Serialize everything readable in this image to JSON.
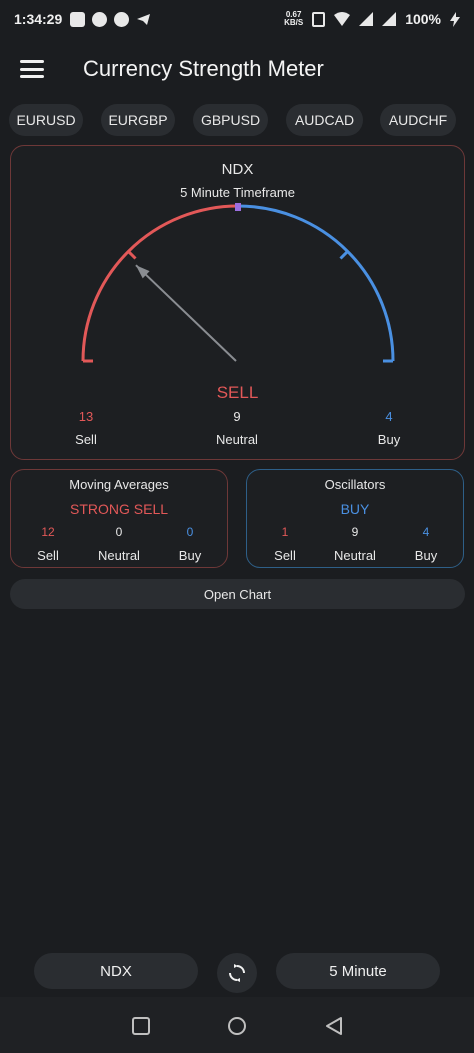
{
  "status_bar": {
    "time": "1:34:29",
    "speed_value": "0.67",
    "speed_unit": "KB/S",
    "battery": "100%"
  },
  "app_bar": {
    "title": "Currency Strength Meter"
  },
  "pairs": [
    "EURUSD",
    "EURGBP",
    "GBPUSD",
    "AUDCAD",
    "AUDCHF"
  ],
  "summary": {
    "symbol": "NDX",
    "timeframe": "5 Minute Timeframe",
    "verdict": "SELL",
    "sell_count": "13",
    "neutral_count": "9",
    "buy_count": "4",
    "sell_label": "Sell",
    "neutral_label": "Neutral",
    "buy_label": "Buy",
    "gauge_needle_fraction": 0.24
  },
  "moving_averages": {
    "title": "Moving Averages",
    "verdict": "STRONG SELL",
    "sell_count": "12",
    "neutral_count": "0",
    "buy_count": "0",
    "sell_label": "Sell",
    "neutral_label": "Neutral",
    "buy_label": "Buy"
  },
  "oscillators": {
    "title": "Oscillators",
    "verdict": "BUY",
    "sell_count": "1",
    "neutral_count": "9",
    "buy_count": "4",
    "sell_label": "Sell",
    "neutral_label": "Neutral",
    "buy_label": "Buy"
  },
  "open_chart_label": "Open Chart",
  "bottom": {
    "symbol_button": "NDX",
    "timeframe_button": "5 Minute"
  },
  "colors": {
    "sell": "#e25858",
    "buy": "#4a90e2",
    "neutral": "#e8e8e8",
    "background": "#1b1d20"
  }
}
